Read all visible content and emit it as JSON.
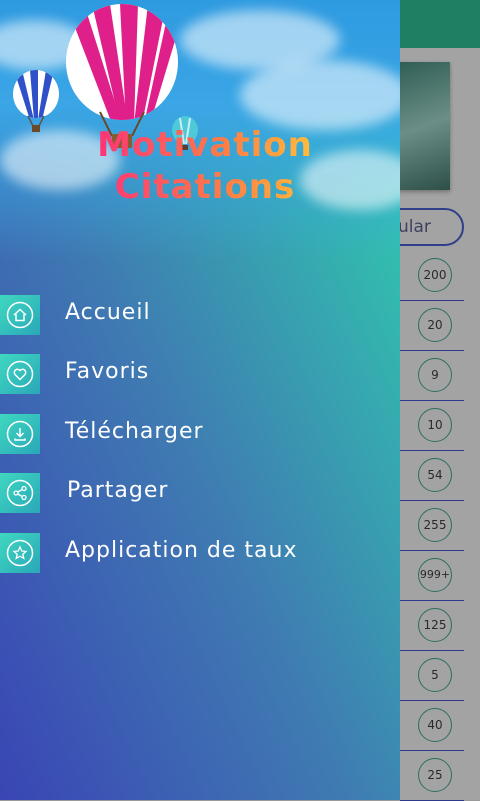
{
  "app": {
    "title_line1": "Motivation",
    "title_line2": "Citations"
  },
  "menu": {
    "items": [
      {
        "label": "Accueil",
        "icon": "home-icon"
      },
      {
        "label": "Favoris",
        "icon": "heart-icon"
      },
      {
        "label": "Télécharger",
        "icon": "download-icon"
      },
      {
        "label": "Partager",
        "icon": "share-icon"
      },
      {
        "label": "Application de taux",
        "icon": "star-icon"
      }
    ]
  },
  "background": {
    "tab_label": "ular",
    "counts": [
      "200",
      "20",
      "9",
      "10",
      "54",
      "255",
      "999+",
      "125",
      "5",
      "40",
      "25"
    ]
  },
  "colors": {
    "toolbar": "#1f7f63",
    "drawer_start": "#3a45b4",
    "drawer_end": "#2dd7ad",
    "icon_box": "#3fd8c0"
  }
}
